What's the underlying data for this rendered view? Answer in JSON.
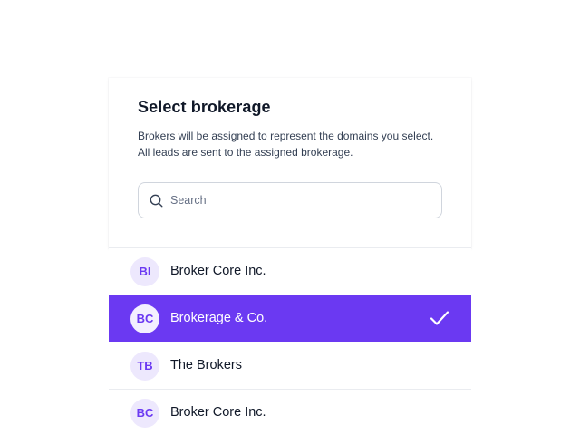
{
  "dialog": {
    "title": "Select brokerage",
    "description": "Brokers will be assigned to represent the domains you select. All leads are sent to the assigned brokerage.",
    "search": {
      "placeholder": "Search",
      "value": "",
      "icon": "search-icon"
    }
  },
  "brokerages": [
    {
      "initials": "BI",
      "name": "Broker Core Inc.",
      "selected": false
    },
    {
      "initials": "BC",
      "name": "Brokerage & Co.",
      "selected": true
    },
    {
      "initials": "TB",
      "name": "The Brokers",
      "selected": false
    },
    {
      "initials": "BC",
      "name": "Broker Core Inc.",
      "selected": false
    }
  ],
  "icons": {
    "selected_marker": "check-icon"
  },
  "colors": {
    "accent": "#6b39f2",
    "avatar_bg": "#ede8fd",
    "text_primary": "#101828",
    "text_secondary": "#344054",
    "border": "#d0d5dd"
  }
}
